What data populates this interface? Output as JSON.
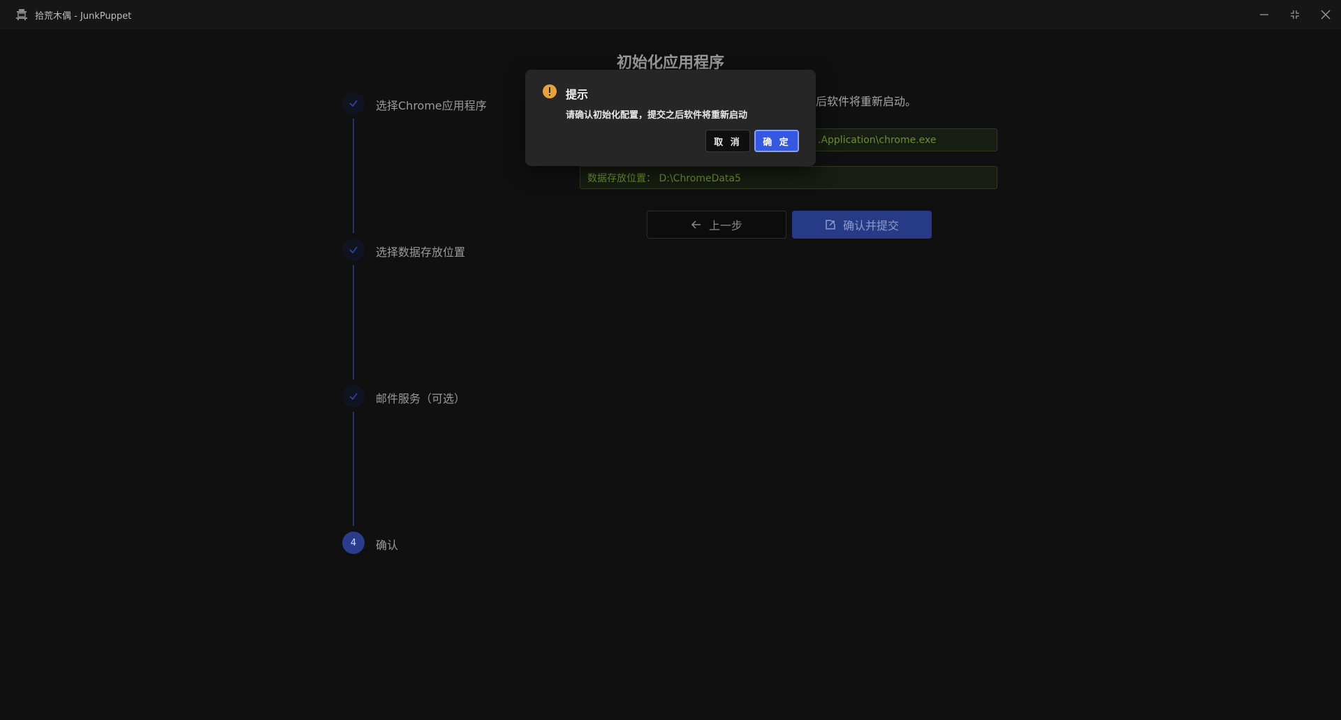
{
  "window": {
    "title": "拾荒木偶 - JunkPuppet"
  },
  "page": {
    "title": "初始化应用程序",
    "description": "后软件将重新启动。"
  },
  "steps": [
    {
      "label": "选择Chrome应用程序",
      "status": "done"
    },
    {
      "label": "选择数据存放位置",
      "status": "done"
    },
    {
      "label": "邮件服务（可选）",
      "status": "done"
    },
    {
      "label": "确认",
      "status": "active",
      "number": "4"
    }
  ],
  "fields": {
    "chrome_path": ".Application\\chrome.exe",
    "data_location": "数据存放位置： D:\\ChromeData5"
  },
  "buttons": {
    "prev_label": "上一步",
    "submit_label": "确认并提交"
  },
  "modal": {
    "title": "提示",
    "message": "请确认初始化配置，提交之后软件将重新启动",
    "cancel_label": "取 消",
    "ok_label": "确 定"
  },
  "colors": {
    "accent": "#3458e0",
    "warning": "#e6a23c",
    "field_text": "#6b8f3a"
  }
}
